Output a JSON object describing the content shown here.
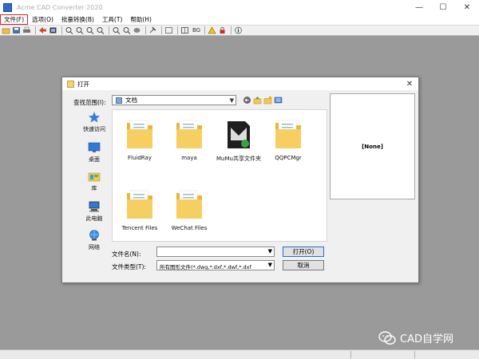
{
  "app": {
    "title": "Acme CAD Converter 2020",
    "window_controls": {
      "minimize": "—",
      "maximize": "☐",
      "close": "✕"
    }
  },
  "menubar": {
    "items": [
      {
        "label": "文件(F)",
        "highlighted": true
      },
      {
        "label": "选项(O)"
      },
      {
        "label": "批量转换(B)"
      },
      {
        "label": "工具(T)"
      },
      {
        "label": "帮助(H)"
      }
    ],
    "highlight_color": "#e02020"
  },
  "toolbar": {
    "bg_label": "BG",
    "icons": [
      "open-icon",
      "save-icon",
      "print-icon",
      "convert-icon",
      "zoom-in-icon",
      "zoom-out-icon",
      "zoom-window-icon",
      "zoom-fit-icon",
      "pan-icon",
      "layers-icon",
      "bg-toggle",
      "warning-icon",
      "info-icon"
    ]
  },
  "dialog": {
    "title": "打开",
    "close_glyph": "✕",
    "lookin": {
      "label": "查找范围(I):",
      "value": "文档"
    },
    "places": [
      {
        "label": "快速访问",
        "icon": "star-icon"
      },
      {
        "label": "桌面",
        "icon": "desktop-icon"
      },
      {
        "label": "库",
        "icon": "library-icon"
      },
      {
        "label": "此电脑",
        "icon": "computer-icon"
      },
      {
        "label": "网络",
        "icon": "network-icon"
      }
    ],
    "files": [
      {
        "name": "FluidRay",
        "icon": "folder-icon"
      },
      {
        "name": "maya",
        "icon": "folder-icon"
      },
      {
        "name": "MuMu共享文件夹",
        "icon": "mumu-folder-icon"
      },
      {
        "name": "QQPCMgr",
        "icon": "folder-icon"
      },
      {
        "name": "Tencent Files",
        "icon": "folder-icon"
      },
      {
        "name": "WeChat Files",
        "icon": "folder-icon"
      }
    ],
    "preview_text": "[None]",
    "filename": {
      "label": "文件名(N):",
      "value": ""
    },
    "filetype": {
      "label": "文件类型(T):",
      "value": "所有图形文件(*.dwg,*.dxf,*.dwf,*.dxf"
    },
    "open_button": "打开(O)",
    "cancel_button": "取消"
  },
  "watermark": {
    "text": "CAD自学网"
  },
  "colors": {
    "workspace": "#9a9a9a",
    "folder_yellow": "#f3c653",
    "accent_blue": "#2a70c8"
  }
}
